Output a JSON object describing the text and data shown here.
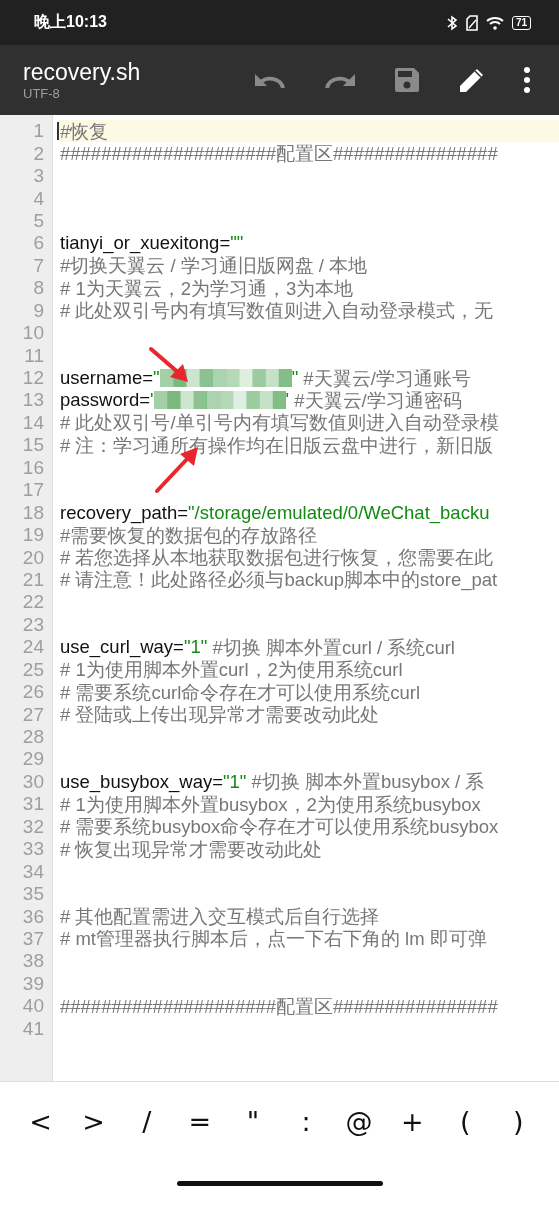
{
  "status_bar": {
    "time": "晚上10:13",
    "battery": "71"
  },
  "toolbar": {
    "title": "recovery.sh",
    "encoding": "UTF-8",
    "actions": [
      {
        "kind": "undo",
        "disabled": true
      },
      {
        "kind": "redo",
        "disabled": true
      },
      {
        "kind": "save",
        "disabled": true
      },
      {
        "kind": "edit",
        "disabled": false
      },
      {
        "kind": "more",
        "disabled": false
      }
    ]
  },
  "editor": {
    "lines": [
      {
        "number": "1",
        "current": true,
        "segments": [
          {
            "kind": "comment",
            "text": "#恢复"
          }
        ]
      },
      {
        "number": "2",
        "current": false,
        "segments": [
          {
            "kind": "comment",
            "text": "#####################配置区################"
          }
        ]
      },
      {
        "number": "3",
        "current": false
      },
      {
        "number": "4",
        "current": false
      },
      {
        "number": "5",
        "current": false
      },
      {
        "number": "6",
        "current": false,
        "segments": [
          {
            "kind": "code",
            "text": "tianyi_or_xuexitong="
          },
          {
            "kind": "string",
            "text": "\"\""
          }
        ]
      },
      {
        "number": "7",
        "current": false,
        "segments": [
          {
            "kind": "comment",
            "text": "#切换天翼云 / 学习通旧版网盘 / 本地"
          }
        ]
      },
      {
        "number": "8",
        "current": false,
        "segments": [
          {
            "kind": "comment",
            "text": "# 1为天翼云，2为学习通，3为本地"
          }
        ]
      },
      {
        "number": "9",
        "current": false,
        "segments": [
          {
            "kind": "comment",
            "text": "# 此处双引号内有填写数值则进入自动登录模式，无"
          }
        ]
      },
      {
        "number": "10",
        "current": false
      },
      {
        "number": "11",
        "current": false
      },
      {
        "number": "12",
        "current": false,
        "segments": [
          {
            "kind": "code",
            "text": "username="
          },
          {
            "kind": "string",
            "text": "\""
          },
          {
            "kind": "redacted"
          },
          {
            "kind": "string",
            "text": "\""
          },
          {
            "kind": "comment",
            "text": " #天翼云/学习通账号"
          }
        ]
      },
      {
        "number": "13",
        "current": false,
        "segments": [
          {
            "kind": "code",
            "text": "password="
          },
          {
            "kind": "string",
            "text": "'"
          },
          {
            "kind": "redacted"
          },
          {
            "kind": "string",
            "text": "'"
          },
          {
            "kind": "comment",
            "text": " #天翼云/学习通密码"
          }
        ]
      },
      {
        "number": "14",
        "current": false,
        "segments": [
          {
            "kind": "comment",
            "text": "# 此处双引号/单引号内有填写数值则进入自动登录模"
          }
        ]
      },
      {
        "number": "15",
        "current": false,
        "segments": [
          {
            "kind": "comment",
            "text": "# 注：学习通所有操作均在旧版云盘中进行，新旧版"
          }
        ]
      },
      {
        "number": "16",
        "current": false
      },
      {
        "number": "17",
        "current": false
      },
      {
        "number": "18",
        "current": false,
        "segments": [
          {
            "kind": "code",
            "text": "recovery_path="
          },
          {
            "kind": "string",
            "text": "\"/storage/emulated/0/WeChat_backu"
          }
        ]
      },
      {
        "number": "19",
        "current": false,
        "segments": [
          {
            "kind": "comment",
            "text": "#需要恢复的数据包的存放路径"
          }
        ]
      },
      {
        "number": "20",
        "current": false,
        "segments": [
          {
            "kind": "comment",
            "text": "# 若您选择从本地获取数据包进行恢复，您需要在此"
          }
        ]
      },
      {
        "number": "21",
        "current": false,
        "segments": [
          {
            "kind": "comment",
            "text": "# 请注意！此处路径必须与backup脚本中的store_pat"
          }
        ]
      },
      {
        "number": "22",
        "current": false
      },
      {
        "number": "23",
        "current": false
      },
      {
        "number": "24",
        "current": false,
        "segments": [
          {
            "kind": "code",
            "text": "use_curl_way="
          },
          {
            "kind": "string",
            "text": "\"1\""
          },
          {
            "kind": "comment",
            "text": " #切换 脚本外置curl / 系统curl"
          }
        ]
      },
      {
        "number": "25",
        "current": false,
        "segments": [
          {
            "kind": "comment",
            "text": "# 1为使用脚本外置curl，2为使用系统curl"
          }
        ]
      },
      {
        "number": "26",
        "current": false,
        "segments": [
          {
            "kind": "comment",
            "text": "# 需要系统curl命令存在才可以使用系统curl"
          }
        ]
      },
      {
        "number": "27",
        "current": false,
        "segments": [
          {
            "kind": "comment",
            "text": "# 登陆或上传出现异常才需要改动此处"
          }
        ]
      },
      {
        "number": "28",
        "current": false
      },
      {
        "number": "29",
        "current": false
      },
      {
        "number": "30",
        "current": false,
        "segments": [
          {
            "kind": "code",
            "text": "use_busybox_way="
          },
          {
            "kind": "string",
            "text": "\"1\""
          },
          {
            "kind": "comment",
            "text": " #切换 脚本外置busybox / 系"
          }
        ]
      },
      {
        "number": "31",
        "current": false,
        "segments": [
          {
            "kind": "comment",
            "text": "# 1为使用脚本外置busybox，2为使用系统busybox"
          }
        ]
      },
      {
        "number": "32",
        "current": false,
        "segments": [
          {
            "kind": "comment",
            "text": "# 需要系统busybox命令存在才可以使用系统busybox"
          }
        ]
      },
      {
        "number": "33",
        "current": false,
        "segments": [
          {
            "kind": "comment",
            "text": "# 恢复出现异常才需要改动此处"
          }
        ]
      },
      {
        "number": "34",
        "current": false
      },
      {
        "number": "35",
        "current": false
      },
      {
        "number": "36",
        "current": false,
        "segments": [
          {
            "kind": "comment",
            "text": "# 其他配置需进入交互模式后自行选择"
          }
        ]
      },
      {
        "number": "37",
        "current": false,
        "segments": [
          {
            "kind": "comment",
            "text": "# mt管理器执行脚本后，点一下右下角的 lm 即可弹"
          }
        ]
      },
      {
        "number": "38",
        "current": false
      },
      {
        "number": "39",
        "current": false
      },
      {
        "number": "40",
        "current": false,
        "segments": [
          {
            "kind": "comment",
            "text": "#####################配置区################"
          }
        ]
      },
      {
        "number": "41",
        "current": false
      }
    ]
  },
  "symbol_keys": [
    "<",
    ">",
    "/",
    "=",
    "\"",
    ":",
    "@",
    "+",
    "(",
    ")"
  ]
}
